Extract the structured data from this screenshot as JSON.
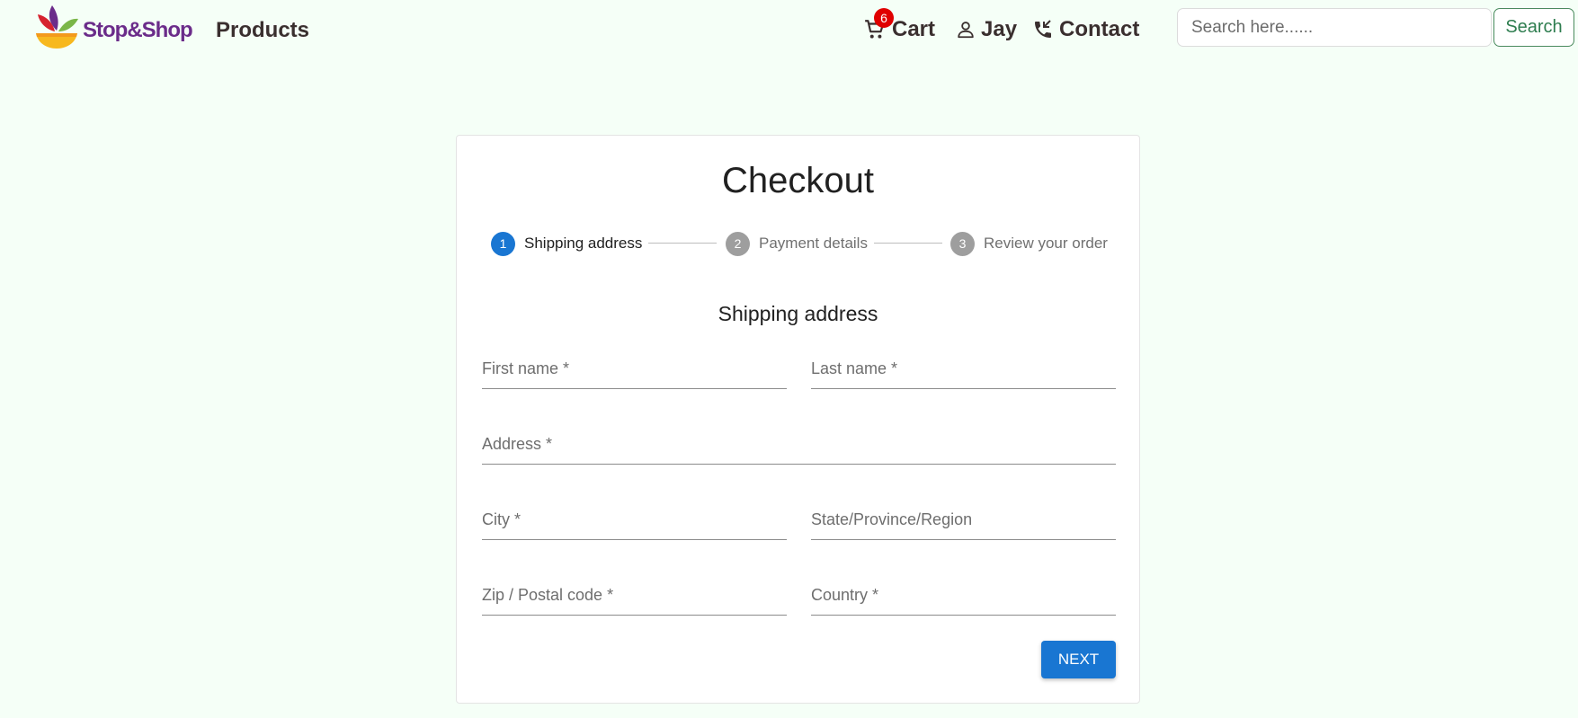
{
  "navbar": {
    "logo": {
      "brand": "Stop&Shop",
      "icon": "stop-and-shop-logo-icon"
    },
    "products_label": "Products",
    "cart": {
      "label": "Cart",
      "count": "6",
      "icon": "cart-icon"
    },
    "user": {
      "label": "Jay",
      "icon": "user-icon"
    },
    "contact": {
      "label": "Contact",
      "icon": "phone-icon"
    },
    "search": {
      "placeholder": "Search here......",
      "value": "",
      "button_label": "Search"
    }
  },
  "checkout": {
    "title": "Checkout",
    "steps": [
      {
        "number": "1",
        "label": "Shipping address",
        "state": "active"
      },
      {
        "number": "2",
        "label": "Payment details",
        "state": "inactive"
      },
      {
        "number": "3",
        "label": "Review your order",
        "state": "inactive"
      }
    ],
    "section_title": "Shipping address",
    "fields": {
      "first_name": {
        "placeholder": "First name *",
        "value": ""
      },
      "last_name": {
        "placeholder": "Last name *",
        "value": ""
      },
      "address": {
        "placeholder": "Address *",
        "value": ""
      },
      "city": {
        "placeholder": "City *",
        "value": ""
      },
      "state": {
        "placeholder": "State/Province/Region",
        "value": ""
      },
      "zip": {
        "placeholder": "Zip / Postal code *",
        "value": ""
      },
      "country": {
        "placeholder": "Country *",
        "value": ""
      }
    },
    "next_label": "NEXT"
  },
  "colors": {
    "background": "#f5fff7",
    "primary": "#1976d2",
    "brand_purple": "#6b2c8a",
    "badge_red": "#e00000",
    "search_green": "#2e7d4f"
  }
}
